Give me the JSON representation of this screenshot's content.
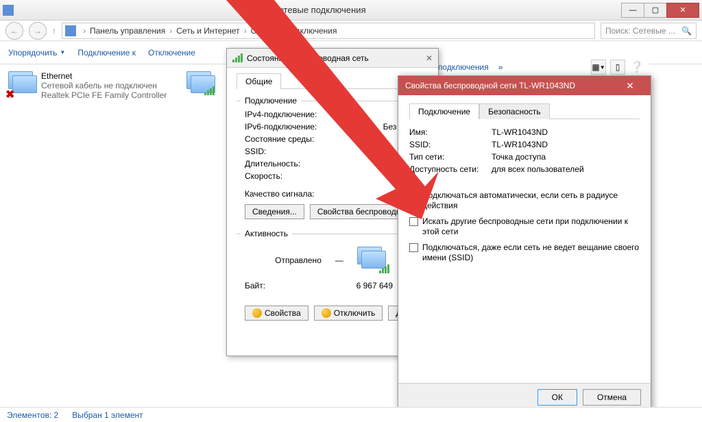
{
  "window": {
    "title": "Сетевые подключения",
    "appicon": "network"
  },
  "breadcrumb": {
    "items": [
      "Панель управления",
      "Сеть и Интернет",
      "Сетевые подключения"
    ]
  },
  "search": {
    "placeholder": "Поиск: Сетевые ..."
  },
  "toolbar": {
    "organize": "Упорядочить",
    "connect_to": "Подключение к",
    "disable": "Отключение",
    "rename_partial": "ование подключения",
    "chevrons": "»"
  },
  "connections": {
    "ethernet": {
      "name": "Ethernet",
      "status": "Сетевой кабель не подключен",
      "adapter": "Realtek PCIe FE Family Controller"
    }
  },
  "status_dialog": {
    "title": "Состояние - Беспроводная сеть",
    "tab_general": "Общие",
    "group_connection": "Подключение",
    "ipv4_label": "IPv4-подключение:",
    "ipv6_label": "IPv6-подключение:",
    "ipv6_value": "Без досту",
    "env_label": "Состояние среды:",
    "ssid_label": "SSID:",
    "duration_label": "Длительность:",
    "speed_label": "Скорость:",
    "quality_label": "Качество сигнала:",
    "btn_details": "Сведения...",
    "btn_wireless_props": "Свойства беспроводной",
    "group_activity": "Активность",
    "sent_label": "Отправлено",
    "bytes_label": "Байт:",
    "bytes_sent": "6 967 649",
    "btn_props": "Свойства",
    "btn_disable": "Отключить",
    "btn_diag": "Диагн"
  },
  "props_dialog": {
    "title": "Свойства беспроводной сети TL-WR1043ND",
    "tab_connection": "Подключение",
    "tab_security": "Безопасность",
    "name_label": "Имя:",
    "name_value": "TL-WR1043ND",
    "ssid_label": "SSID:",
    "ssid_value": "TL-WR1043ND",
    "nettype_label": "Тип сети:",
    "nettype_value": "Точка доступа",
    "avail_label": "Доступность сети:",
    "avail_value": "для всех пользователей",
    "chk_auto": "Подключаться автоматически, если сеть в радиусе действия",
    "chk_search": "Искать другие беспроводные сети при подключении к этой сети",
    "chk_hidden": "Подключаться, даже если сеть не ведет вещание своего имени (SSID)",
    "btn_ok": "ОК",
    "btn_cancel": "Отмена"
  },
  "statusbar": {
    "elements": "Элементов: 2",
    "selected": "Выбран 1 элемент"
  }
}
